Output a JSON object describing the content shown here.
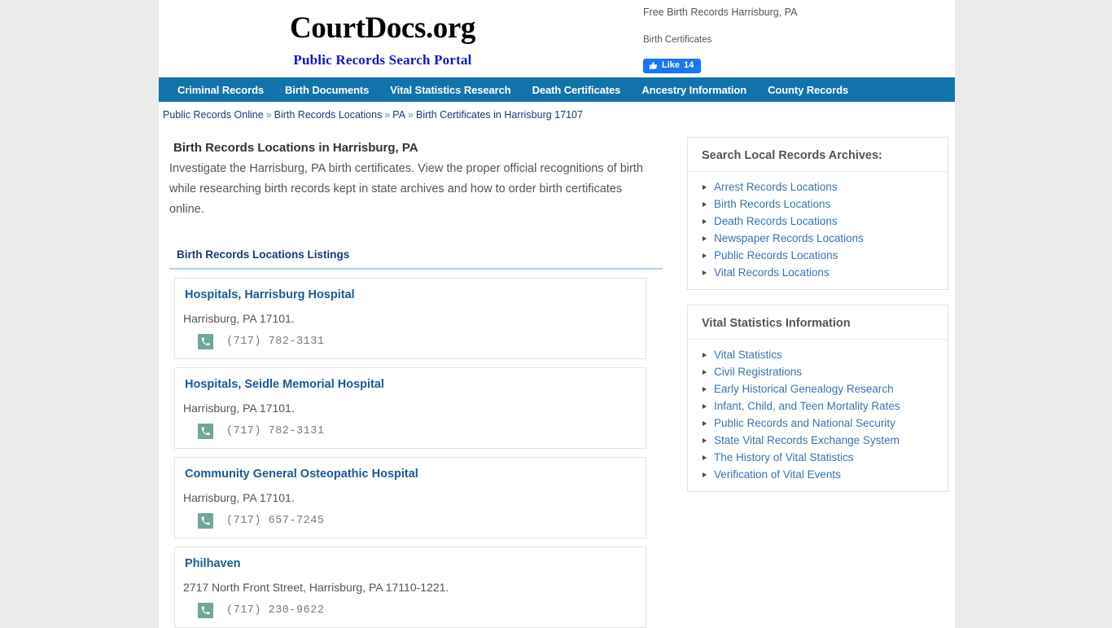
{
  "site": {
    "logo_title": "CourtDocs.org",
    "logo_tagline": "Public Records Search Portal"
  },
  "header": {
    "tagline_1": "Free Birth Records Harrisburg, PA",
    "tagline_2": "Birth Certificates",
    "like_label": "Like",
    "like_count": "14"
  },
  "nav": {
    "items": [
      {
        "label": "Criminal Records"
      },
      {
        "label": "Birth Documents"
      },
      {
        "label": "Vital Statistics Research"
      },
      {
        "label": "Death Certificates"
      },
      {
        "label": "Ancestry Information"
      },
      {
        "label": "County Records"
      }
    ]
  },
  "breadcrumb": {
    "separator": "»",
    "items": [
      {
        "label": "Public Records Online"
      },
      {
        "label": "Birth Records Locations"
      },
      {
        "label": "PA"
      },
      {
        "label": "Birth Certificates in Harrisburg 17107"
      }
    ]
  },
  "main": {
    "title": "Birth Records Locations in Harrisburg, PA",
    "intro": "Investigate the Harrisburg, PA birth certificates. View the proper official recognitions of birth while researching birth records kept in state archives and how to order birth certificates online.",
    "section_header": "Birth Records Locations Listings",
    "listings": [
      {
        "name": "Hospitals, Harrisburg Hospital",
        "address": "Harrisburg, PA 17101.",
        "phone": "(717) 782-3131"
      },
      {
        "name": "Hospitals, Seidle Memorial Hospital",
        "address": "Harrisburg, PA 17101.",
        "phone": "(717) 782-3131"
      },
      {
        "name": "Community General Osteopathic Hospital",
        "address": "Harrisburg, PA 17101.",
        "phone": "(717) 657-7245"
      },
      {
        "name": "Philhaven",
        "address": "2717 North Front Street, Harrisburg, PA 17110-1221.",
        "phone": "(717) 230-9622"
      }
    ]
  },
  "sidebar": {
    "boxes": [
      {
        "title": "Search Local Records Archives:",
        "links": [
          {
            "label": "Arrest Records Locations"
          },
          {
            "label": "Birth Records Locations"
          },
          {
            "label": "Death Records Locations"
          },
          {
            "label": "Newspaper Records Locations"
          },
          {
            "label": "Public Records Locations"
          },
          {
            "label": "Vital Records Locations"
          }
        ]
      },
      {
        "title": "Vital Statistics Information",
        "links": [
          {
            "label": "Vital Statistics"
          },
          {
            "label": "Civil Registrations"
          },
          {
            "label": "Early Historical Genealogy Research"
          },
          {
            "label": "Infant, Child, and Teen Mortality Rates"
          },
          {
            "label": "Public Records and National Security"
          },
          {
            "label": "State Vital Records Exchange System"
          },
          {
            "label": "The History of Vital Statistics"
          },
          {
            "label": "Verification of Vital Events"
          }
        ]
      }
    ]
  },
  "colors": {
    "nav_bar": "#1273ab",
    "page_background": "#ebebeb",
    "link_blue": "#3973ad",
    "listing_title_blue": "#1a5a96",
    "breadcrumb_blue": "#1a3a78",
    "facebook_blue": "#1877f2",
    "phone_icon_teal": "#6fa79a",
    "section_underline": "#a8d8e8"
  }
}
